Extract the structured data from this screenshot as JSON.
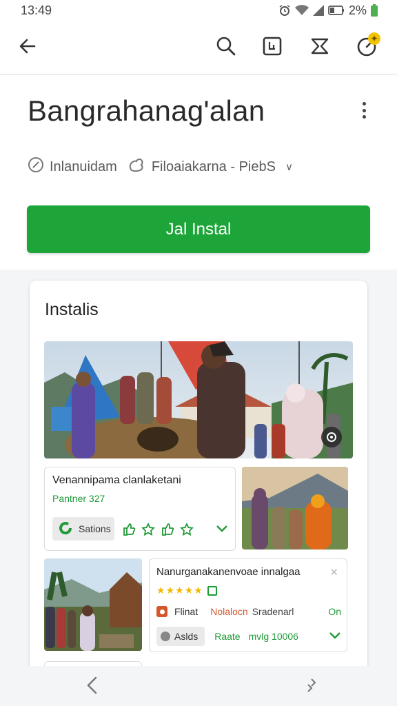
{
  "status_bar": {
    "time": "13:49",
    "battery_text": "2%",
    "icons": [
      "alarm-icon",
      "wifi-icon",
      "signal-icon",
      "battery-icon"
    ]
  },
  "app_bar": {
    "icons": [
      "back-arrow-icon",
      "search-icon",
      "screenshot-icon",
      "share-icon",
      "notification-icon"
    ],
    "badge_icon": "sparkle"
  },
  "app": {
    "title": "Bangrahanag'alan",
    "meta_1": "Inlanuidam",
    "meta_2": "Filoaiakarna - PiebS"
  },
  "install_button": {
    "label": "Jal Instal",
    "color": "#1da53a"
  },
  "card": {
    "title": "Instalis",
    "hero_photo": "crowd-at-rally-photo",
    "tile_1": {
      "name": "Venannipama clanlaketani",
      "rating": "Pantner 327",
      "status_label": "Sations"
    },
    "tile_2": {
      "name": "Nanurganakanenvoae innalgaa",
      "row_a": [
        "Flinat",
        "Nolalocn",
        "Sradenarl",
        "On"
      ],
      "chip": "Aslds",
      "row_b": [
        "Raate",
        "mvlg 10006"
      ]
    }
  },
  "nav_bar": {
    "icons": [
      "back-nav-icon",
      "rotate-icon"
    ]
  },
  "colors": {
    "accent_green": "#1da53a",
    "orange": "#d2582c",
    "star": "#f2b700"
  }
}
